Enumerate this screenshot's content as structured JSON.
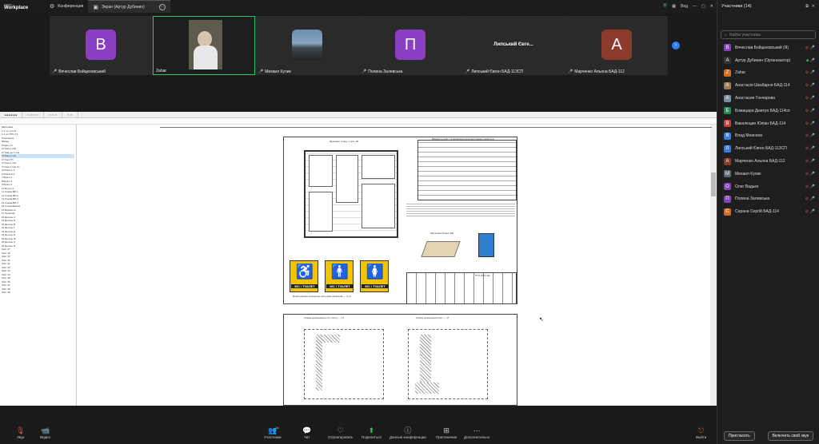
{
  "app": {
    "brand_top": "zoom",
    "brand_main": "Workplace"
  },
  "tabs": [
    {
      "label": "Конференция",
      "icon": "chat-icon"
    },
    {
      "label": "Экран (Артур Дубинин)",
      "icon": "screen-icon"
    }
  ],
  "topbar": {
    "view_label": "Вид"
  },
  "video_strip": [
    {
      "name": "Вячеслав Бойцеховський",
      "initial": "B",
      "color": "#8a3fc2"
    },
    {
      "name": "Zahar",
      "kind": "video"
    },
    {
      "name": "Михаил Кулик",
      "kind": "photo"
    },
    {
      "name": "Полина Залевська",
      "initial": "П",
      "color": "#8a3fc2"
    },
    {
      "name": "Липський Євген БАД-113СП",
      "bigname": "Липський Євге..."
    },
    {
      "name": "Марченко Альона БАД-112",
      "initial": "A",
      "color": "#8b3a2b"
    }
  ],
  "participants_panel": {
    "title": "Участники (14)",
    "search_placeholder": "Найти участника",
    "participants": [
      {
        "name": "Вячеслав Бойцеховський (Я)",
        "initial": "B",
        "color": "#8a3fc2"
      },
      {
        "name": "Артур Дубинин (Организатор)",
        "initial": "A",
        "color": "#333",
        "video": true
      },
      {
        "name": "Zahar",
        "initial": "Z",
        "color": "#d86b1e"
      },
      {
        "name": "Анастасія Шкабарня БАД-114",
        "initial": "A",
        "color": "#a07a55"
      },
      {
        "name": "Анастасия Гончарова",
        "initial": "A",
        "color": "#7a8fa3"
      },
      {
        "name": "Бомацара Дмитро БАД-114сп",
        "initial": "Б",
        "color": "#1f8f5a"
      },
      {
        "name": "Вакалюцин Юліан БАД-114",
        "initial": "В",
        "color": "#d23b3b"
      },
      {
        "name": "Влад Моисеев",
        "initial": "В",
        "color": "#2d7ff9"
      },
      {
        "name": "Липський Євген БАД-113СП",
        "initial": "Л",
        "color": "#2d7ff9"
      },
      {
        "name": "Марченко Альона БАД-112",
        "initial": "A",
        "color": "#8b3a2b"
      },
      {
        "name": "Михаил Кулик",
        "initial": "М",
        "color": "#5a6b78"
      },
      {
        "name": "Олег Вадько",
        "initial": "O",
        "color": "#8a3fc2"
      },
      {
        "name": "Полина Залевська",
        "initial": "П",
        "color": "#8a3fc2"
      },
      {
        "name": "Сарана Сергій БАД-114",
        "initial": "C",
        "color": "#d86b1e"
      }
    ],
    "invite_label": "Пригласить",
    "mute_all_label": "Включить свой звук"
  },
  "bottom_toolbar": [
    {
      "label": "Звук",
      "icon": "mic-muted-icon"
    },
    {
      "label": "Видео",
      "icon": "video-off-icon"
    },
    {
      "label": "Участники",
      "icon": "participants-icon",
      "count": "14"
    },
    {
      "label": "Чат",
      "icon": "chat-icon"
    },
    {
      "label": "Отреагировать",
      "icon": "heart-icon"
    },
    {
      "label": "Поделиться",
      "icon": "share-icon"
    },
    {
      "label": "Данные конференции",
      "icon": "info-icon"
    },
    {
      "label": "Приложения",
      "icon": "apps-icon"
    },
    {
      "label": "Дополнительно",
      "icon": "more-icon"
    },
    {
      "label": "Выйти",
      "icon": "leave-icon"
    }
  ],
  "shared_doc": {
    "sign_labels": [
      "WC / ТУАЛЕТ",
      "WC / ТУАЛЕТ",
      "WC / ТУАЛЕТ"
    ],
    "plan_title": "Фрагмент плану 1 пов. 1Е",
    "spec_title": "Відомість робіт та матеріалів на влаштування санвузла",
    "detail_1_title": "Схема розміщення стін. площ. — 1Г",
    "detail_2_title": "Схема розміщення плит — 1Г",
    "bench_title": "Металева бісанк обм",
    "stamp_code": "ПГП 2024 НЕ",
    "sign_caption": "Влаштування позначень-піктограм санвузлів — 2 шт",
    "tree_items": [
      "Заголовок",
      "1-1 шт р.1-10",
      "1.1 шт ПР 1 Г1",
      "Пояснення",
      "Фасад",
      "Розріз 1-1",
      "2 План 1 пов",
      "2 План до 1 пов.",
      "2 План 2 пов",
      "3 План ГП",
      "4 План 1 пов",
      "4 План 1 пов (1)",
      "5 Розріз 1-1",
      "6 Розріз 2-2",
      "7 Вузол 1",
      "8 Вузол 2",
      "9 Вузол 3",
      "10 Вузол 4",
      "11 Схема ВР-1",
      "12 Схема ВР-2",
      "13 Схема ВР-3",
      "14 Схема ВР-4",
      "15 Специфікація",
      "16 Відомість",
      "17 Примітки",
      "18 Деталь А",
      "19 Деталь Б",
      "20 Деталь В",
      "21 Деталь Г",
      "22 Деталь Д",
      "23 Деталь Е",
      "24 Деталь Ж",
      "25 Деталь З",
      "26 Деталь И",
      "Лист 27",
      "Лист 28",
      "Лист 29",
      "Лист 30",
      "Лист 31",
      "Лист 32",
      "Лист 33",
      "Лист 34",
      "Лист 35",
      "Лист 36",
      "Лист 37",
      "Лист 38",
      "Лист 39"
    ]
  }
}
